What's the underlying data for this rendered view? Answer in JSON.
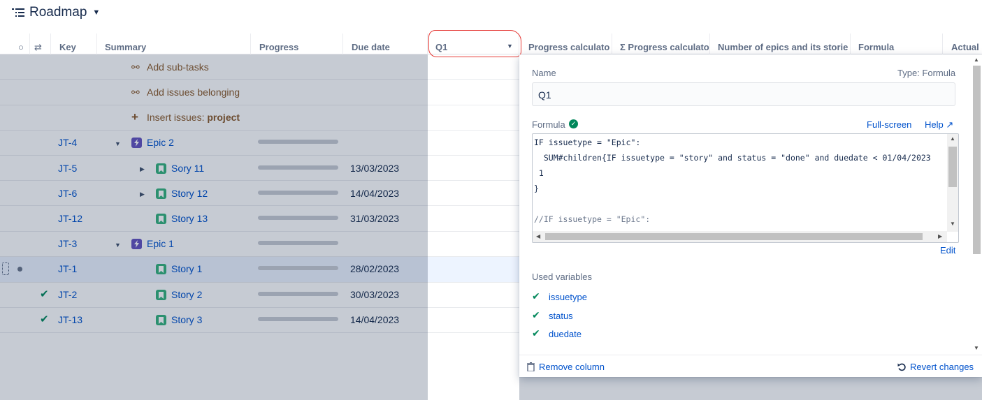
{
  "header": {
    "title": "Roadmap"
  },
  "columns": {
    "key": "Key",
    "summary": "Summary",
    "progress": "Progress",
    "due_date": "Due date",
    "q1": "Q1",
    "progress_calc": "Progress calculato",
    "sum_progress_calc": "Σ Progress calculato",
    "num_epics": "Number of epics and its storie",
    "formula": "Formula",
    "actual": "Actual"
  },
  "actions": {
    "add_subtasks": "Add sub-tasks",
    "add_issues": "Add issues belonging",
    "insert_prefix": "Insert issues: ",
    "insert_target": "project"
  },
  "rows": [
    {
      "key": "JT-4",
      "summary": "Epic 2",
      "due": ""
    },
    {
      "key": "JT-5",
      "summary": "Sory 11",
      "due": "13/03/2023"
    },
    {
      "key": "JT-6",
      "summary": "Story 12",
      "due": "14/04/2023"
    },
    {
      "key": "JT-12",
      "summary": "Story 13",
      "due": "31/03/2023"
    },
    {
      "key": "JT-3",
      "summary": "Epic 1",
      "due": ""
    },
    {
      "key": "JT-1",
      "summary": "Story 1",
      "due": "28/02/2023"
    },
    {
      "key": "JT-2",
      "summary": "Story 2",
      "due": "30/03/2023"
    },
    {
      "key": "JT-13",
      "summary": "Story 3",
      "due": "14/04/2023"
    }
  ],
  "panel": {
    "name_label": "Name",
    "type_label": "Type: Formula",
    "name_value": "Q1",
    "formula_label": "Formula",
    "fullscreen": "Full-screen",
    "help": "Help ↗",
    "code": [
      "IF issuetype = \"Epic\":",
      "  SUM#children{IF issuetype = \"story\" and status = \"done\" and duedate < 01/04/2023",
      " 1",
      "}",
      "",
      "//IF issuetype = \"Epic\":"
    ],
    "edit": "Edit",
    "used_variables_label": "Used variables",
    "variables": [
      "issuetype",
      "status",
      "duedate"
    ],
    "remove_column": "Remove column",
    "revert_changes": "Revert changes"
  },
  "colors": {
    "accent": "#0052cc",
    "success": "#00875a",
    "epic": "#6554c0",
    "story": "#36b37e",
    "annotation": "#e53935"
  }
}
